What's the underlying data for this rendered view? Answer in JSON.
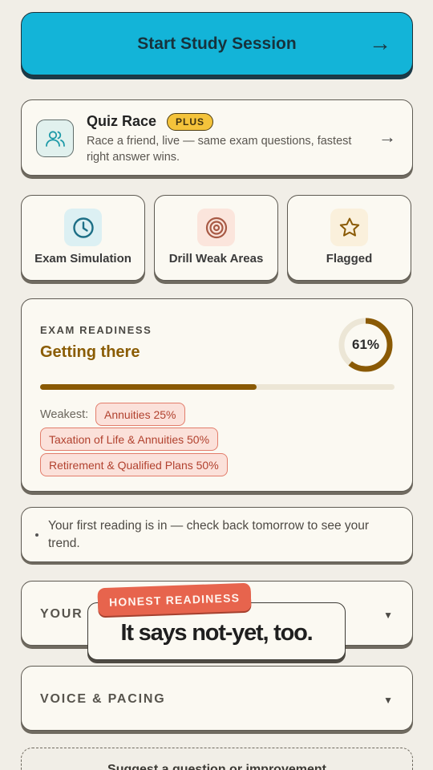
{
  "cta": {
    "label": "Start Study Session",
    "arrow": "→"
  },
  "quiz_race": {
    "title": "Quiz Race",
    "badge": "PLUS",
    "description": "Race a friend, live — same exam questions, fastest right answer wins.",
    "arrow": "→",
    "icon": "users-icon"
  },
  "modes": [
    {
      "label": "Exam Simulation",
      "icon": "clock-icon",
      "icon_bg": "#dcf0f3",
      "icon_color": "#1d6f86"
    },
    {
      "label": "Drill Weak Areas",
      "icon": "target-icon",
      "icon_bg": "#fbe5dc",
      "icon_color": "#a85a45"
    },
    {
      "label": "Flagged",
      "icon": "star-icon",
      "icon_bg": "#faf0dc",
      "icon_color": "#8a5a05"
    }
  ],
  "readiness": {
    "kicker": "EXAM READINESS",
    "status": "Getting there",
    "percent": 61,
    "percent_label": "61%",
    "weakest_label": "Weakest:",
    "weak_areas": [
      "Annuities 25%",
      "Taxation of Life & Annuities 50%",
      "Retirement & Qualified Plans 50%"
    ],
    "accent_color": "#8a5a05"
  },
  "note": {
    "text": "Your first reading is in — check back tomorrow to see your trend."
  },
  "sections": [
    {
      "label": "YOUR PROGRESS",
      "caret": "▼"
    },
    {
      "label": "VOICE & PACING",
      "caret": "▼"
    }
  ],
  "suggest": {
    "label": "Suggest a question or improvement"
  },
  "overlay": {
    "badge": "HONEST READINESS",
    "headline": "It says not-yet, too."
  }
}
